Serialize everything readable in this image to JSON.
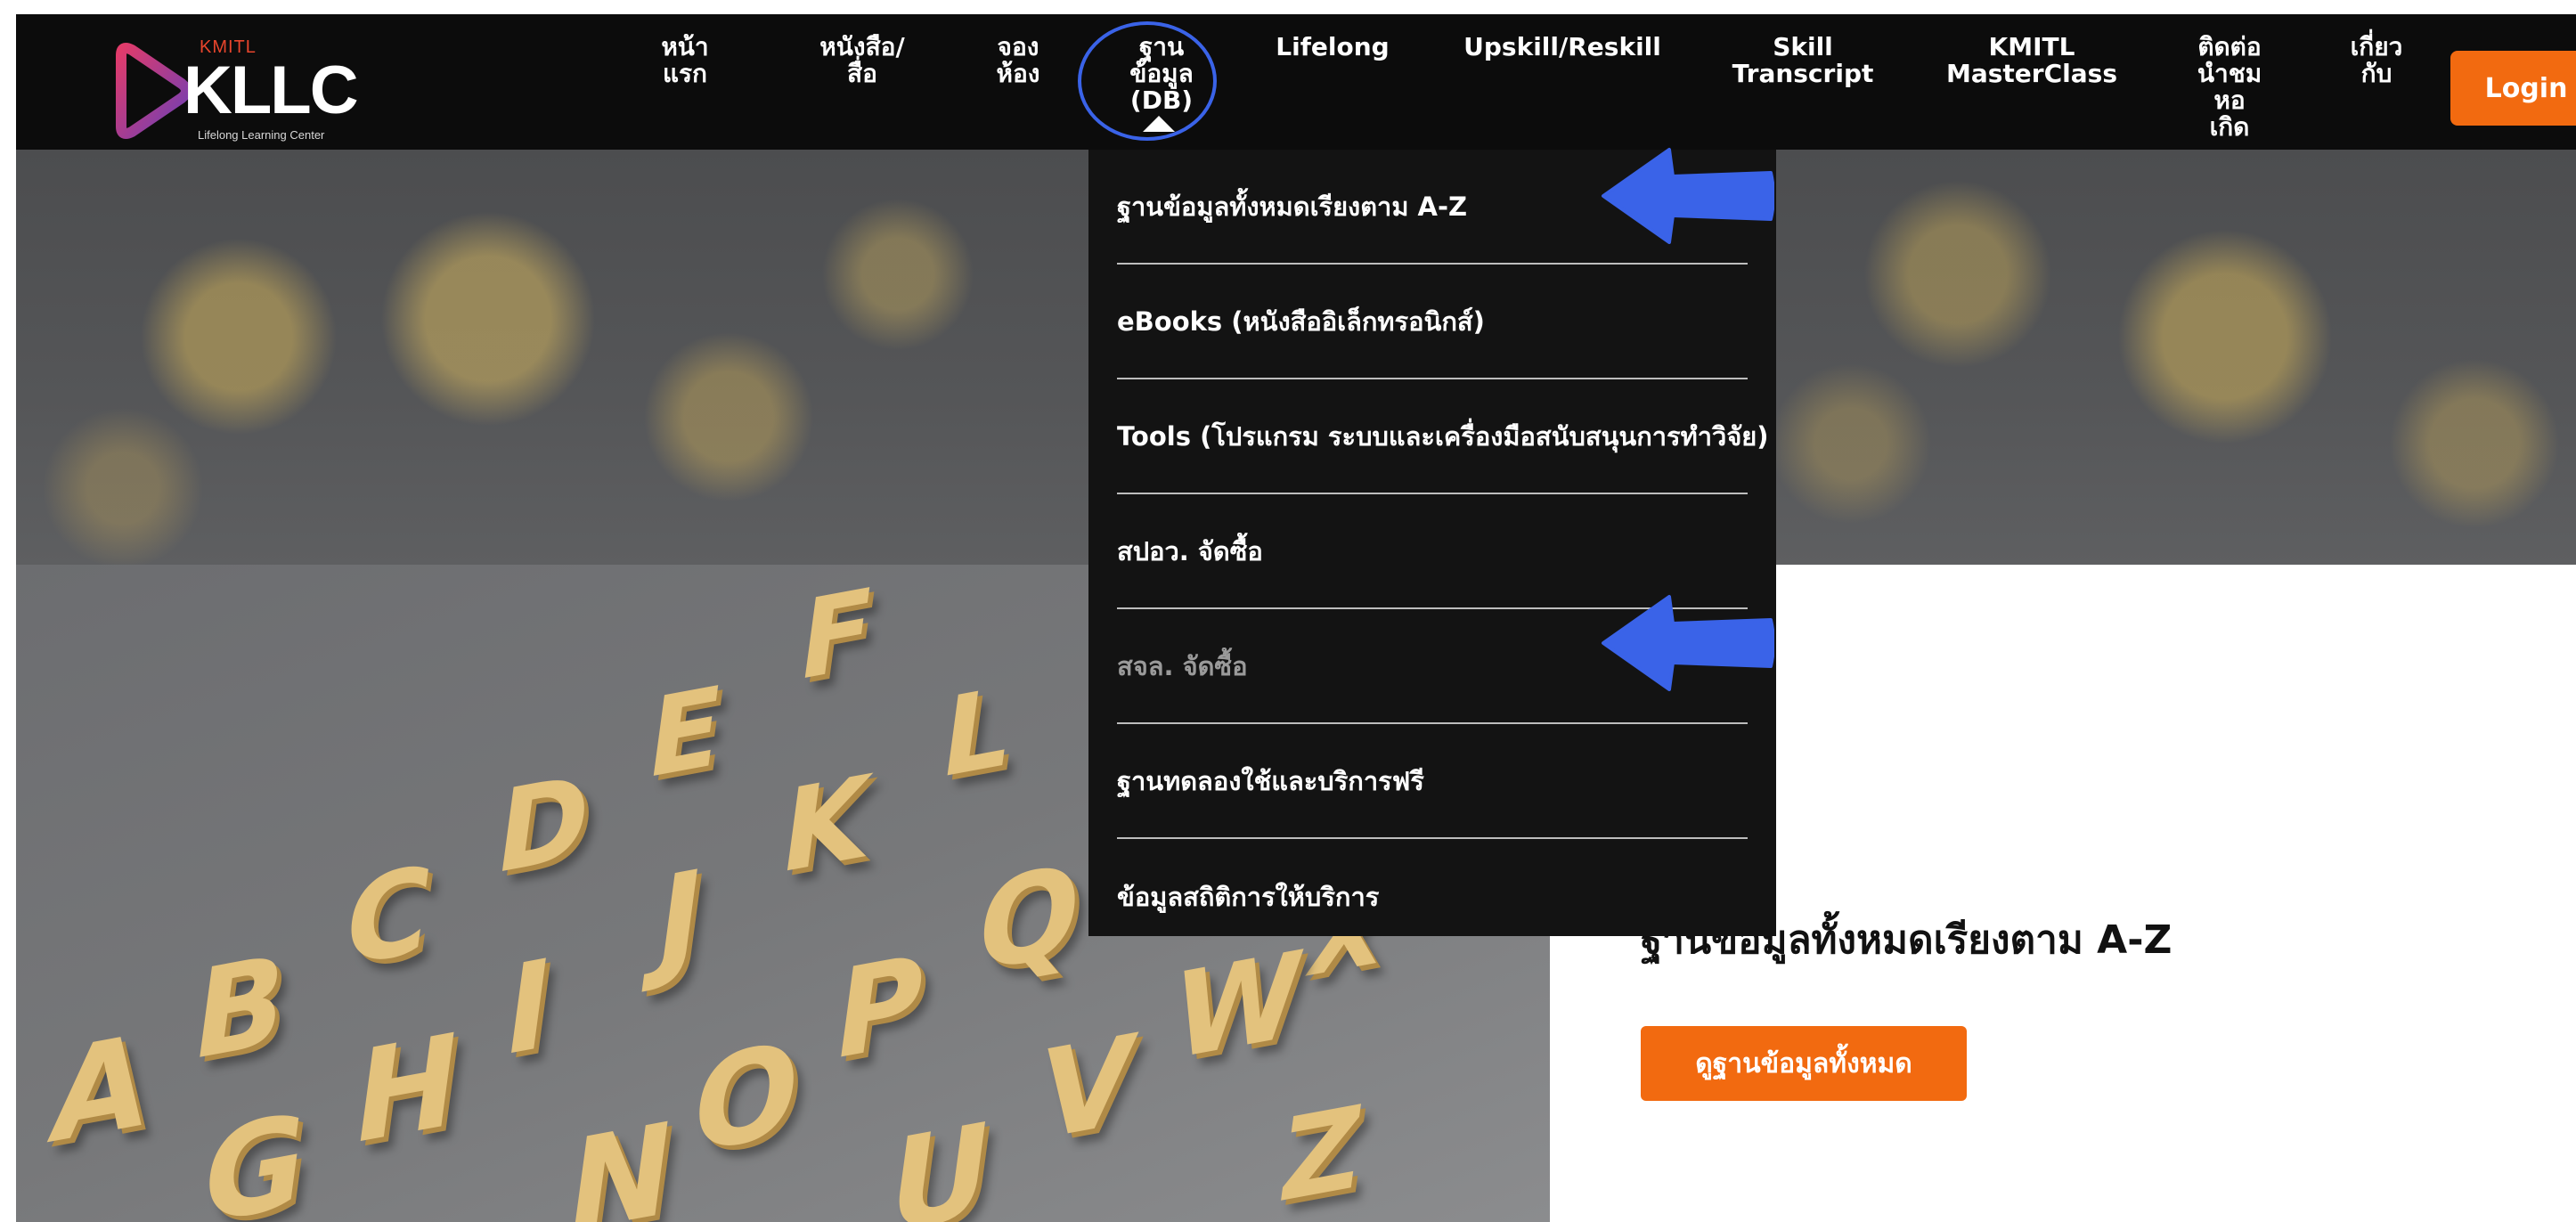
{
  "logo": {
    "brand_top": "KMITL",
    "brand": "KLLC",
    "tagline": "Lifelong Learning Center"
  },
  "nav": {
    "items": [
      {
        "label": "หน้า\nแรก"
      },
      {
        "label": "หนังสือ/\nสื่อ"
      },
      {
        "label": "จอง\nห้อง"
      },
      {
        "label": "ฐาน\nข้อมูล\n(DB)"
      },
      {
        "label": "Lifelong"
      },
      {
        "label": "Upskill/Reskill"
      },
      {
        "label": "Skill\nTranscript"
      },
      {
        "label": "KMITL\nMasterClass"
      },
      {
        "label": "ติดต่อ\nนำชม\nหอ\nเกิด"
      },
      {
        "label": "เกี่ยว\nกับ"
      }
    ],
    "login_label": "Login"
  },
  "dropdown": {
    "items": [
      {
        "label": "ฐานข้อมูลทั้งหมดเรียงตาม A-Z"
      },
      {
        "label": "eBooks (หนังสืออิเล็กทรอนิกส์)"
      },
      {
        "label": "Tools (โปรแกรม ระบบและเครื่องมือสนับสนุนการทำวิจัย)"
      },
      {
        "label": "สปอว. จัดซื้อ"
      },
      {
        "label": "สจล. จัดซื้อ"
      },
      {
        "label": "ฐานทดลองใช้และบริการฟรี"
      },
      {
        "label": "ข้อมูลสถิติการให้บริการ"
      }
    ]
  },
  "content": {
    "title": "ฐานข้อมูลทั้งหมดเรียงตาม A-Z",
    "button_label": "ดูฐานข้อมูลทั้งหมด"
  },
  "letters": [
    "F",
    "E",
    "L",
    "D",
    "K",
    "C",
    "J",
    "Q",
    "B",
    "I",
    "P",
    "X",
    "A",
    "H",
    "O",
    "W",
    "V",
    "G",
    "N",
    "U",
    "Z"
  ],
  "colors": {
    "accent": "#f26a10",
    "annotation": "#3a63e8",
    "navbar": "#0c0c0c",
    "dropdown": "#131313"
  }
}
